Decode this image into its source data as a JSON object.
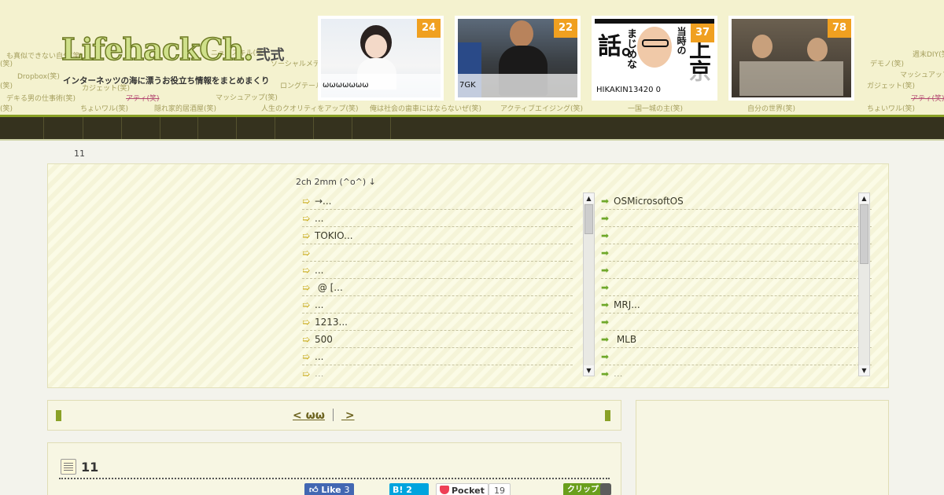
{
  "header": {
    "logo_text": "LifehackCh.",
    "logo_suffix": "弐式",
    "tagline": "インターネッツの海に漂うお役立ち情報をまとめまくり",
    "bg_tags": [
      "も真似できない自分(笑)",
      "ニュースキル(笑)",
      "ソーシャルメデ",
      "Dropbox(笑)",
      "(笑)",
      "カジェット(笑)",
      "ロングテール",
      "アティ(笑)",
      "マッシュアップ(笑)",
      "デキる男の仕事術(笑)",
      "ちょいワル(笑)",
      "隠れ家的居酒屋(笑)",
      "人生のクオリティをアップ(笑)",
      "俺は社会の歯車にはならないぜ(笑)",
      "アクティブエイジング(笑)",
      "一国一城の主(笑)",
      "自分の世界(笑)",
      "ちょいワル(笑)",
      "デモノ(笑)",
      "週末DIY(笑)",
      "マッシュアップ",
      "ガジェット(笑)",
      "アティ(笑)",
      "(笑)",
      "(笑)"
    ]
  },
  "featured": [
    {
      "count": "24",
      "caption": "ωωωωωωω",
      "color": "#f0a020"
    },
    {
      "count": "22",
      "caption": "7GK",
      "color": "#f0a020"
    },
    {
      "count": "37",
      "caption": "HIKAKIN13420 0",
      "thumb_text_a": "上京",
      "thumb_text_b": "当時の",
      "thumb_text_c": "まじめな",
      "thumb_text_d": "話。",
      "color": "#f0a020"
    },
    {
      "count": "78",
      "caption": "",
      "color": "#f0a020"
    }
  ],
  "breadcrumb": "11",
  "ranking": {
    "title": "2ch  2mm (^o^) ↓",
    "left_items": [
      "→...",
      "...",
      "TOKIO...",
      "",
      "...",
      " @ [...",
      "...",
      "1213...",
      "500",
      "...",
      "..."
    ],
    "right_items": [
      "OSMicrosoftOS",
      "",
      "",
      "",
      "",
      "",
      "MRJ...",
      "",
      " MLB",
      "",
      "..."
    ],
    "arrow_glyph": "➯",
    "right_arrow_glyph": "➡"
  },
  "pager": {
    "prev_label": "< ωω",
    "next_label": " > "
  },
  "article": {
    "title": "11",
    "fb_label": "Like",
    "fb_count": "3",
    "hatena_label": "B! 2",
    "pocket_label": "Pocket",
    "pocket_count": "19",
    "clip_label": "クリップ"
  },
  "colors": {
    "accent": "#8aa126",
    "nav_bg": "#35321e",
    "header_bg": "#f4f2cf",
    "badge": "#f0a020"
  }
}
